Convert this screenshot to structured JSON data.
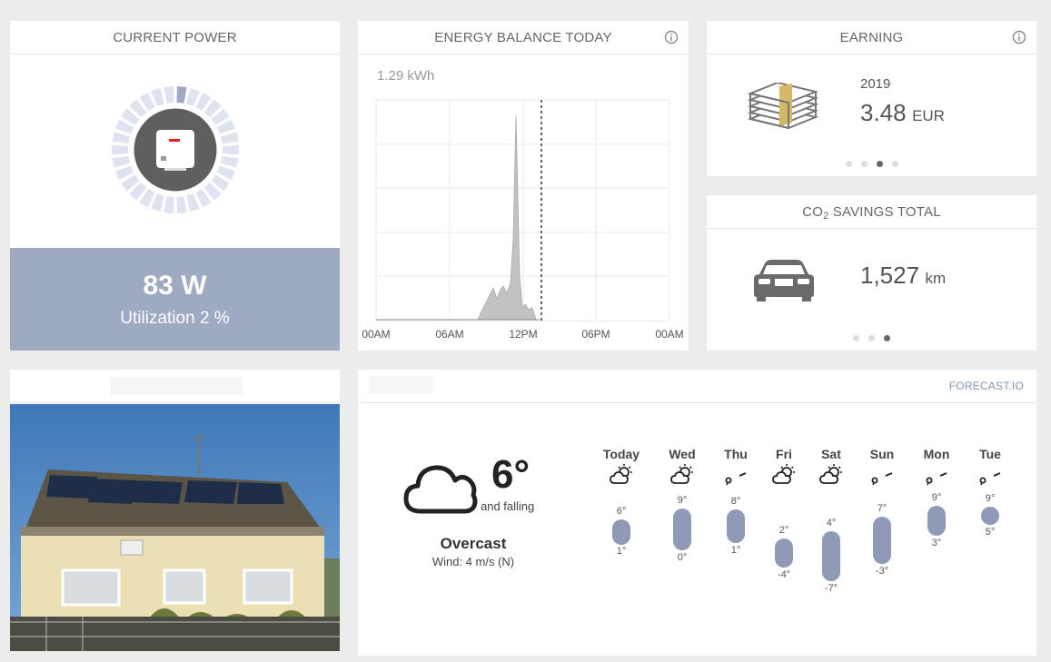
{
  "current_power": {
    "title": "CURRENT POWER",
    "value": "83 W",
    "utilization": "Utilization 2 %"
  },
  "energy_balance": {
    "title": "ENERGY BALANCE TODAY",
    "total": "1.29 kWh",
    "x_labels": [
      "00AM",
      "06AM",
      "12PM",
      "06PM",
      "00AM"
    ]
  },
  "earning": {
    "title": "EARNING",
    "year": "2019",
    "amount": "3.48",
    "currency": "EUR"
  },
  "co2": {
    "title_prefix": "CO",
    "title_sub": "2",
    "title_suffix": " SAVINGS TOTAL",
    "distance": "1,527",
    "unit": "km"
  },
  "weather": {
    "provider": "FORECAST.IO",
    "current_temp": "6°",
    "trend": "and falling",
    "condition": "Overcast",
    "wind": "Wind: 4 m/s (N)",
    "forecast": [
      {
        "day": "Today",
        "high": "6°",
        "low": "1°",
        "icon": "partly-cloudy-icon"
      },
      {
        "day": "Wed",
        "high": "9°",
        "low": "0°",
        "icon": "partly-cloudy-icon"
      },
      {
        "day": "Thu",
        "high": "8°",
        "low": "1°",
        "icon": "rain-icon"
      },
      {
        "day": "Fri",
        "high": "2°",
        "low": "-4°",
        "icon": "partly-cloudy-icon"
      },
      {
        "day": "Sat",
        "high": "4°",
        "low": "-7°",
        "icon": "partly-cloudy-icon"
      },
      {
        "day": "Sun",
        "high": "7°",
        "low": "-3°",
        "icon": "rain-icon"
      },
      {
        "day": "Mon",
        "high": "9°",
        "low": "3°",
        "icon": "rain-icon"
      },
      {
        "day": "Tue",
        "high": "9°",
        "low": "5°",
        "icon": "rain-icon"
      }
    ]
  },
  "colors": {
    "accent": "#9ea9c2",
    "bar": "#8e9ab6",
    "chart_fill": "#c2c2c2"
  }
}
